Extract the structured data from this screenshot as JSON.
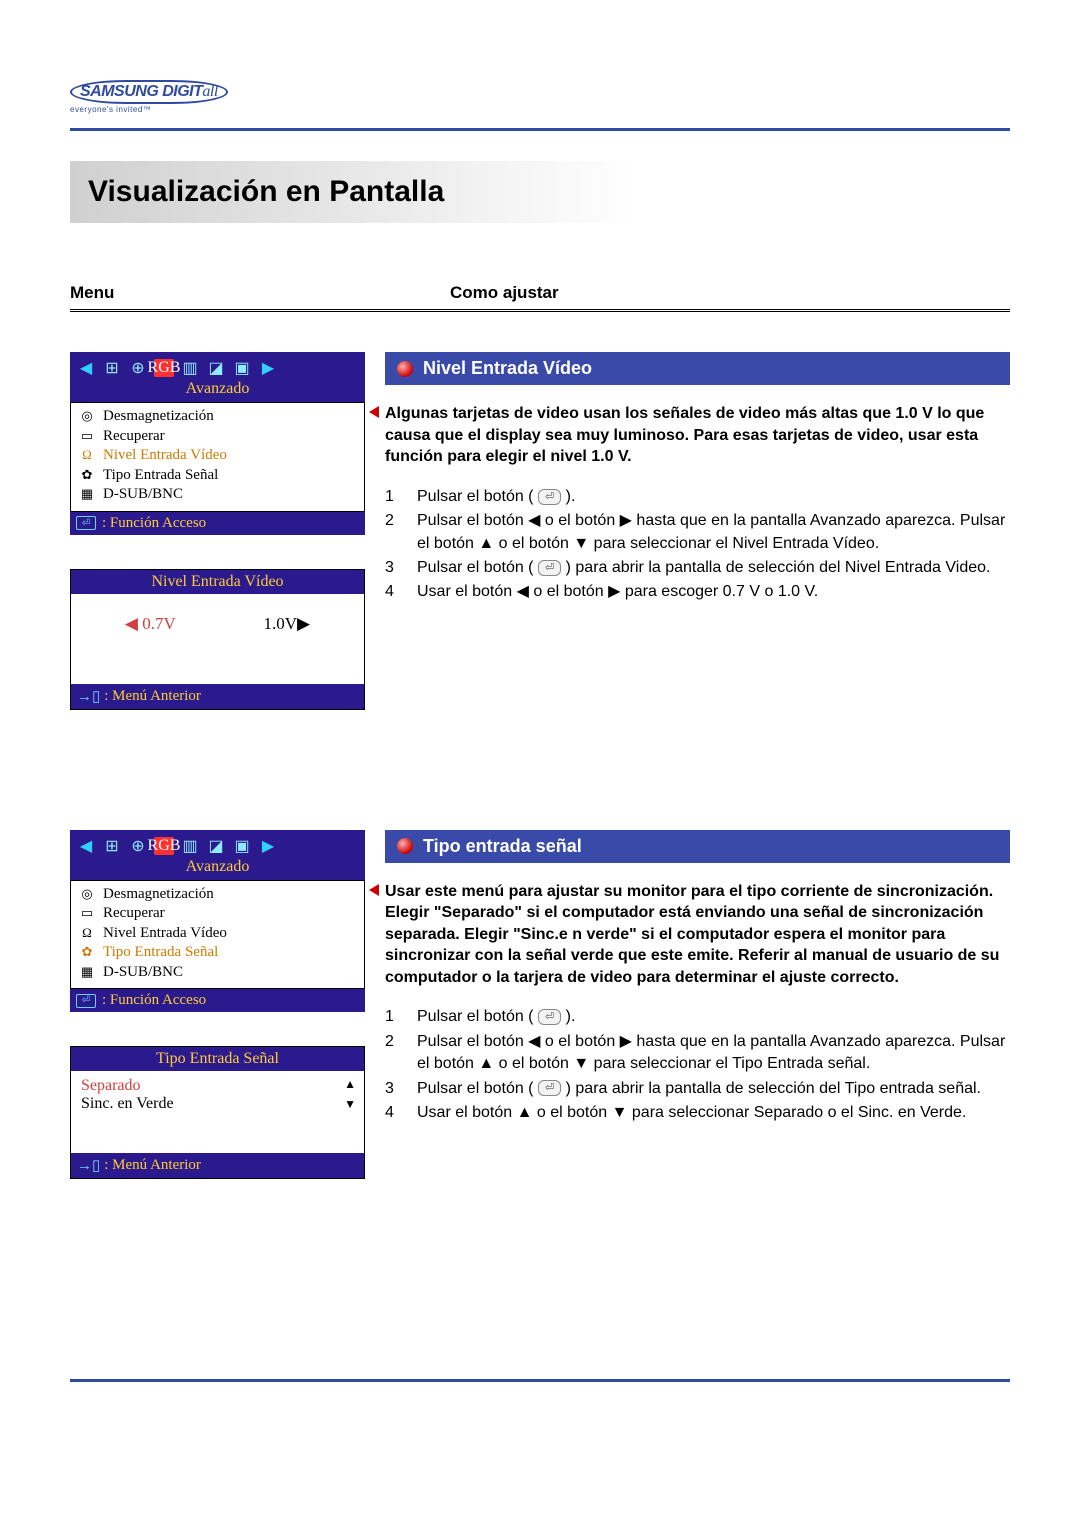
{
  "brand": {
    "name_main": "SAMSUNG DIGIT",
    "name_suffix": "all",
    "tagline": "everyone's invited™"
  },
  "page_title": "Visualización en Pantalla",
  "columns": {
    "left": "Menu",
    "right": "Como ajustar"
  },
  "osd_common": {
    "tab_header": "Avanzado",
    "func_access": ": Función Acceso",
    "menu_prev": ": Menú Anterior",
    "items": [
      {
        "icon": "◎",
        "label": "Desmagnetización"
      },
      {
        "icon": "▭",
        "label": "Recuperar"
      },
      {
        "icon": "Ω",
        "label": "Nivel Entrada Vídeo"
      },
      {
        "icon": "✿",
        "label": "Tipo Entrada Señal"
      },
      {
        "icon": "▦",
        "label": "D-SUB/BNC"
      }
    ]
  },
  "section1": {
    "osd_highlight_index": 2,
    "sub_title": "Nivel Entrada Vídeo",
    "sub_left": "◀ 0.7V",
    "sub_right": "1.0V▶",
    "topic": "Nivel Entrada Vídeo",
    "lead": "Algunas tarjetas de video usan los señales de video más altas que 1.0 V lo que causa que el display sea muy luminoso. Para esas tarjetas de video, usar esta función para elegir el nivel 1.0 V.",
    "steps": [
      "Pulsar el botón ( ⏎ ).",
      "Pulsar el botón ◀ o el botón ▶ hasta que en la pantalla Avanzado aparezca. Pulsar el botón ▲ o el botón ▼ para seleccionar el Nivel Entrada Vídeo.",
      "Pulsar el botón ( ⏎ ) para abrir la pantalla de selección del Nivel Entrada Video.",
      "Usar el botón ◀ o el botón ▶ para escoger 0.7 V o 1.0 V."
    ]
  },
  "section2": {
    "osd_highlight_index": 3,
    "sub_title": "Tipo Entrada Señal",
    "option_sel": "Separado",
    "option_other": "Sinc. en Verde",
    "topic": "Tipo entrada señal",
    "lead": "Usar este menú para ajustar su monitor para el tipo corriente de sincronización. Elegir \"Separado\" si el computador está enviando una señal de sincronización separada. Elegir \"Sinc.e n verde\" si el computador espera el monitor para sincronizar con la señal verde que este emite. Referir al manual de usuario de su computador o la tarjera de video para determinar el ajuste correcto.",
    "steps": [
      "Pulsar el botón ( ⏎ ).",
      "Pulsar el botón ◀ o el botón ▶ hasta que en la pantalla Avanzado aparezca.  Pulsar el botón ▲ o el botón ▼ para seleccionar el Tipo Entrada señal.",
      "Pulsar el botón ( ⏎ ) para abrir la pantalla de selección del Tipo entrada señal.",
      "Usar el botón ▲ o el botón ▼ para seleccionar Separado o el Sinc. en Verde."
    ]
  },
  "chart_data": null
}
